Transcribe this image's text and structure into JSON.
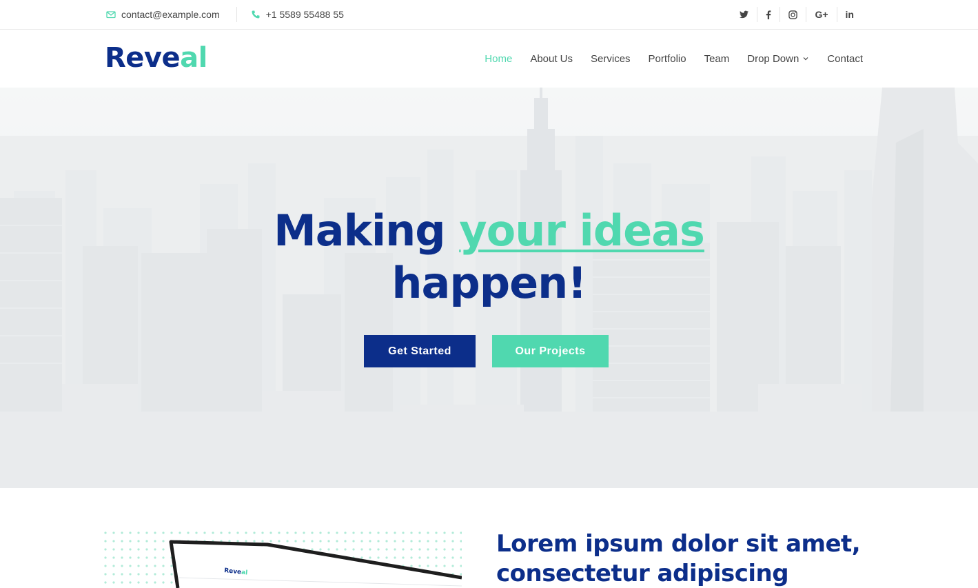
{
  "topbar": {
    "email": "contact@example.com",
    "phone": "+1 5589 55488 55",
    "social": [
      {
        "icon": "twitter-icon",
        "glyph": "🐦"
      },
      {
        "icon": "facebook-icon",
        "glyph": "f"
      },
      {
        "icon": "instagram-icon",
        "glyph": "◎"
      },
      {
        "icon": "google-plus-icon",
        "glyph": "G+"
      },
      {
        "icon": "linkedin-icon",
        "glyph": "in"
      }
    ]
  },
  "logo": {
    "part1": "Reve",
    "part2": "al"
  },
  "nav": {
    "home": "Home",
    "about": "About Us",
    "services": "Services",
    "portfolio": "Portfolio",
    "team": "Team",
    "dropdown": "Drop Down",
    "contact": "Contact"
  },
  "hero": {
    "title_start": "Making ",
    "title_highlight": "your ideas",
    "title_end": "happen!",
    "btn_primary": "Get Started",
    "btn_secondary": "Our Projects"
  },
  "about": {
    "title": "Lorem ipsum dolor sit amet, consectetur adipiscing",
    "mockup_logo_1": "Reve",
    "mockup_logo_2": "al"
  },
  "colors": {
    "brand": "#0c2e8a",
    "accent": "#50d8af",
    "text": "#444444"
  }
}
